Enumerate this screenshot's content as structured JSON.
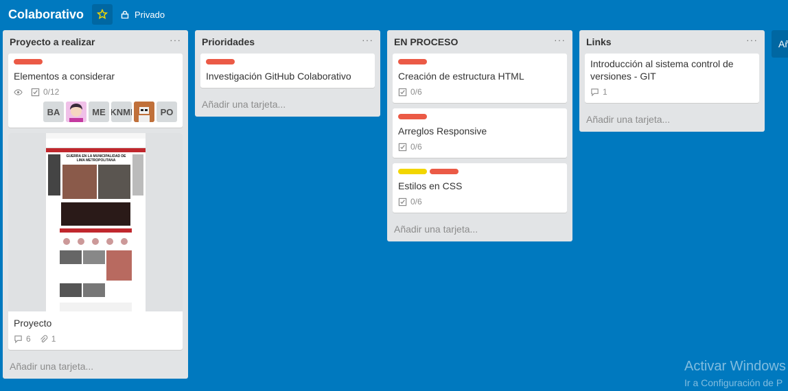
{
  "board": {
    "title": "Colaborativo",
    "visibility": "Privado",
    "star_color": "#f2d600"
  },
  "add_list_label": "Añ",
  "add_card_label": "Añadir una tarjeta...",
  "lists": [
    {
      "title": "Proyecto a realizar",
      "cards": [
        {
          "labels": [
            "#eb5a46"
          ],
          "title": "Elementos a considerar",
          "checklist": "0/12",
          "members": [
            "BA",
            "",
            "ME",
            "KNMI",
            "",
            "PO"
          ]
        },
        {
          "title": "Proyecto",
          "comments": "6",
          "attachments": "1",
          "cover_text": "GUERRA EN LA MUNICIPALIDAD DE LIMA METROPOLITANA"
        }
      ]
    },
    {
      "title": "Prioridades",
      "cards": [
        {
          "labels": [
            "#eb5a46"
          ],
          "title": "Investigación GitHub Colaborativo"
        }
      ]
    },
    {
      "title": "EN PROCESO",
      "cards": [
        {
          "labels": [
            "#eb5a46"
          ],
          "title": "Creación de estructura HTML",
          "checklist": "0/6"
        },
        {
          "labels": [
            "#eb5a46"
          ],
          "title": "Arreglos Responsive",
          "checklist": "0/6"
        },
        {
          "labels": [
            "#f2d600",
            "#eb5a46"
          ],
          "title": "Estilos en CSS",
          "checklist": "0/6"
        }
      ]
    },
    {
      "title": "Links",
      "cards": [
        {
          "title": "Introducción al sistema control de versiones - GIT",
          "comments": "1"
        }
      ]
    }
  ],
  "watermark": {
    "title": "Activar Windows",
    "subtitle": "Ir a Configuración de P"
  }
}
